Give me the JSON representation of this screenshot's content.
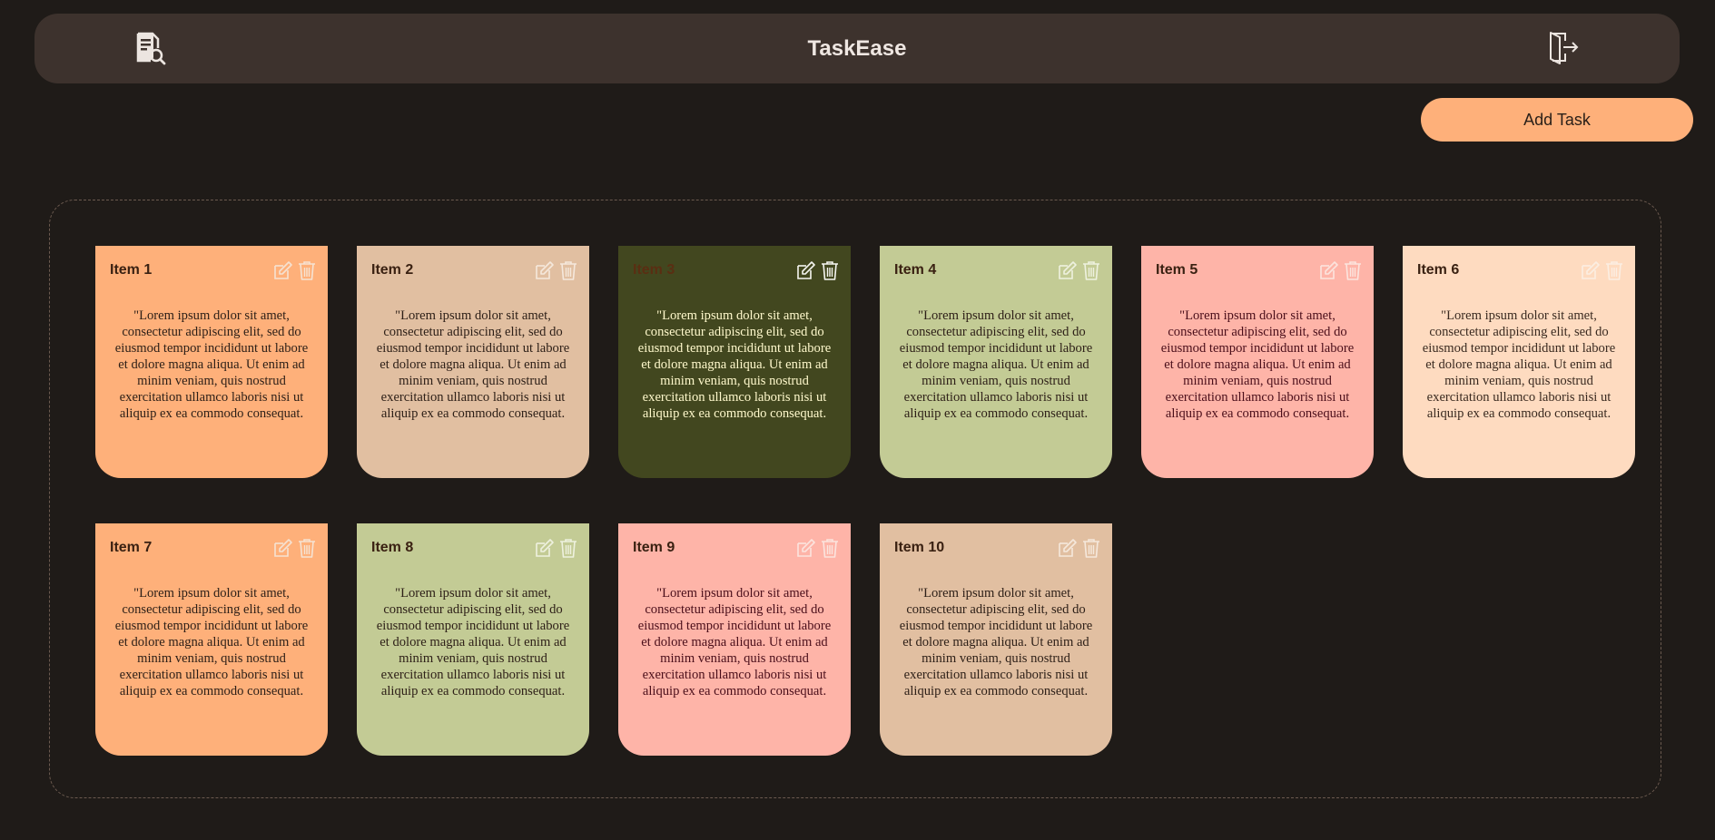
{
  "app": {
    "title": "TaskEase",
    "icons": {
      "left": "document-search-icon",
      "right": "logout-icon"
    }
  },
  "toolbar": {
    "add_label": "Add Task"
  },
  "tasks": [
    {
      "title": "Item 1",
      "body": "\"Lorem ipsum dolor sit amet, consectetur adipiscing elit, sed do eiusmod tempor incididunt ut labore et dolore magna aliqua. Ut enim ad minim veniam, quis nostrud exercitation ullamco laboris nisi ut aliquip ex ea commodo consequat.",
      "color": "#feb07a",
      "text_color": "#2e2018",
      "title_color": "#3a2112",
      "icon_color": "#f5e2d2"
    },
    {
      "title": "Item 2",
      "body": "\"Lorem ipsum dolor sit amet, consectetur adipiscing elit, sed do eiusmod tempor incididunt ut labore et dolore magna aliqua. Ut enim ad minim veniam, quis nostrud exercitation ullamco laboris nisi ut aliquip ex ea commodo consequat.",
      "color": "#e1bfa1",
      "text_color": "#2e2018",
      "title_color": "#3a2112",
      "icon_color": "#f5e8dc"
    },
    {
      "title": "Item 3",
      "body": "\"Lorem ipsum dolor sit amet, consectetur adipiscing elit, sed do eiusmod tempor incididunt ut labore et dolore magna aliqua. Ut enim ad minim veniam, quis nostrud exercitation ullamco laboris nisi ut aliquip ex ea commodo consequat.",
      "color": "#42471f",
      "text_color": "#fff9cc",
      "title_color": "#5a2e12",
      "icon_color": "#f5f5f0"
    },
    {
      "title": "Item 4",
      "body": "\"Lorem ipsum dolor sit amet, consectetur adipiscing elit, sed do eiusmod tempor incididunt ut labore et dolore magna aliqua. Ut enim ad minim veniam, quis nostrud exercitation ullamco laboris nisi ut aliquip ex ea commodo consequat.",
      "color": "#c3cb95",
      "text_color": "#2e2018",
      "title_color": "#3a2112",
      "icon_color": "#eef1df"
    },
    {
      "title": "Item 5",
      "body": "\"Lorem ipsum dolor sit amet, consectetur adipiscing elit, sed do eiusmod tempor incididunt ut labore et dolore magna aliqua. Ut enim ad minim veniam, quis nostrud exercitation ullamco laboris nisi ut aliquip ex ea commodo consequat.",
      "color": "#feb4a8",
      "text_color": "#4a0e1a",
      "title_color": "#3a2112",
      "icon_color": "#fbe4de"
    },
    {
      "title": "Item 6",
      "body": "\"Lorem ipsum dolor sit amet, consectetur adipiscing elit, sed do eiusmod tempor incididunt ut labore et dolore magna aliqua. Ut enim ad minim veniam, quis nostrud exercitation ullamco laboris nisi ut aliquip ex ea commodo consequat.",
      "color": "#fedbc0",
      "text_color": "#3a2a20",
      "title_color": "#3a2112",
      "icon_color": "#fbeee2"
    },
    {
      "title": "Item 7",
      "body": "\"Lorem ipsum dolor sit amet, consectetur adipiscing elit, sed do eiusmod tempor incididunt ut labore et dolore magna aliqua. Ut enim ad minim veniam, quis nostrud exercitation ullamco laboris nisi ut aliquip ex ea commodo consequat.",
      "color": "#feb07a",
      "text_color": "#2e2018",
      "title_color": "#3a2112",
      "icon_color": "#f5e2d2"
    },
    {
      "title": "Item 8",
      "body": "\"Lorem ipsum dolor sit amet, consectetur adipiscing elit, sed do eiusmod tempor incididunt ut labore et dolore magna aliqua. Ut enim ad minim veniam, quis nostrud exercitation ullamco laboris nisi ut aliquip ex ea commodo consequat.",
      "color": "#c3cb95",
      "text_color": "#2e2018",
      "title_color": "#3a2112",
      "icon_color": "#eef1df"
    },
    {
      "title": "Item 9",
      "body": "\"Lorem ipsum dolor sit amet, consectetur adipiscing elit, sed do eiusmod tempor incididunt ut labore et dolore magna aliqua. Ut enim ad minim veniam, quis nostrud exercitation ullamco laboris nisi ut aliquip ex ea commodo consequat.",
      "color": "#feb4a8",
      "text_color": "#4a0e1a",
      "title_color": "#3a2112",
      "icon_color": "#fbe4de"
    },
    {
      "title": "Item 10",
      "body": "\"Lorem ipsum dolor sit amet, consectetur adipiscing elit, sed do eiusmod tempor incididunt ut labore et dolore magna aliqua. Ut enim ad minim veniam, quis nostrud exercitation ullamco laboris nisi ut aliquip ex ea commodo consequat.",
      "color": "#e1bfa1",
      "text_color": "#2e2018",
      "title_color": "#3a2112",
      "icon_color": "#f5e8dc"
    }
  ]
}
